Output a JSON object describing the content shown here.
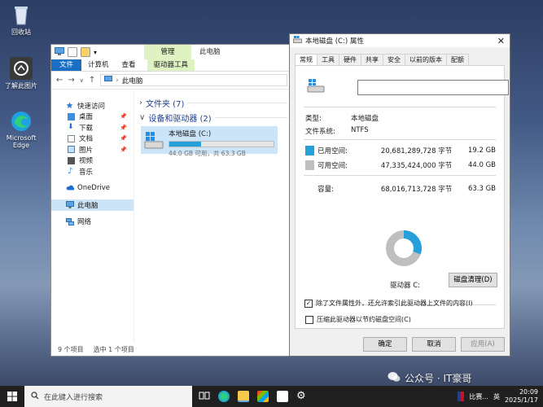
{
  "desktop": {
    "icons": [
      {
        "label": "回收站",
        "icon": "recycle-bin-icon"
      },
      {
        "label": "了解此图片",
        "icon": "spotlight-info-icon"
      },
      {
        "label": "Microsoft Edge",
        "icon": "edge-browser-icon"
      }
    ]
  },
  "explorer": {
    "ribbon_context_tab": "管理",
    "window_title": "此电脑",
    "ribbon_tabs": [
      "文件",
      "计算机",
      "查看",
      "驱动器工具"
    ],
    "address_path": "此电脑",
    "nav_items": [
      {
        "label": "快速访问",
        "icon": "star-icon",
        "pinned": false
      },
      {
        "label": "桌面",
        "icon": "desktop-folder-icon",
        "pinned": true
      },
      {
        "label": "下载",
        "icon": "download-folder-icon",
        "pinned": true
      },
      {
        "label": "文档",
        "icon": "documents-folder-icon",
        "pinned": true
      },
      {
        "label": "图片",
        "icon": "pictures-folder-icon",
        "pinned": true
      },
      {
        "label": "视频",
        "icon": "videos-folder-icon",
        "pinned": false
      },
      {
        "label": "音乐",
        "icon": "music-folder-icon",
        "pinned": false
      },
      {
        "label": "OneDrive",
        "icon": "onedrive-cloud-icon",
        "pinned": false
      },
      {
        "label": "此电脑",
        "icon": "this-pc-icon",
        "pinned": false,
        "selected": true
      },
      {
        "label": "网络",
        "icon": "network-icon",
        "pinned": false
      }
    ],
    "groups": {
      "folders": "文件夹 (7)",
      "devices": "设备和驱动器 (2)"
    },
    "drive": {
      "name": "本地磁盘 (C:)",
      "free_text": "44.0 GB 可用，共 63.3 GB",
      "used_fraction": 0.304
    },
    "status": {
      "count": "9 个项目",
      "selected": "选中 1 个项目"
    }
  },
  "properties": {
    "title": "本地磁盘 (C:) 属性",
    "tabs": [
      "常规",
      "工具",
      "硬件",
      "共享",
      "安全",
      "以前的版本",
      "配额"
    ],
    "active_tab": "常规",
    "name_value": "",
    "type_label": "类型:",
    "type_value": "本地磁盘",
    "fs_label": "文件系统:",
    "fs_value": "NTFS",
    "used_label": "已用空间:",
    "used_bytes": "20,681,289,728 字节",
    "used_gb": "19.2 GB",
    "free_label": "可用空间:",
    "free_bytes": "47,335,424,000 字节",
    "free_gb": "44.0 GB",
    "capacity_label": "容量:",
    "capacity_bytes": "68,016,713,728 字节",
    "capacity_gb": "63.3 GB",
    "drive_label": "驱动器 C:",
    "cleanup_button": "磁盘清理(D)",
    "compress_option": "压缩此驱动器以节约磁盘空间(C)",
    "compress_checked": false,
    "index_option": "除了文件属性外，还允许索引此驱动器上文件的内容(I)",
    "index_checked": true,
    "ok_button": "确定",
    "cancel_button": "取消",
    "apply_button": "应用(A)",
    "colors": {
      "used": "#26a0da",
      "free": "#bfbfbf"
    }
  },
  "taskbar": {
    "search_placeholder": "在此键入进行搜索",
    "ime": "英",
    "time": "20:09",
    "date": "2025/1/17",
    "app_label": "比赛..."
  },
  "watermark": "公众号 · IT豪哥"
}
